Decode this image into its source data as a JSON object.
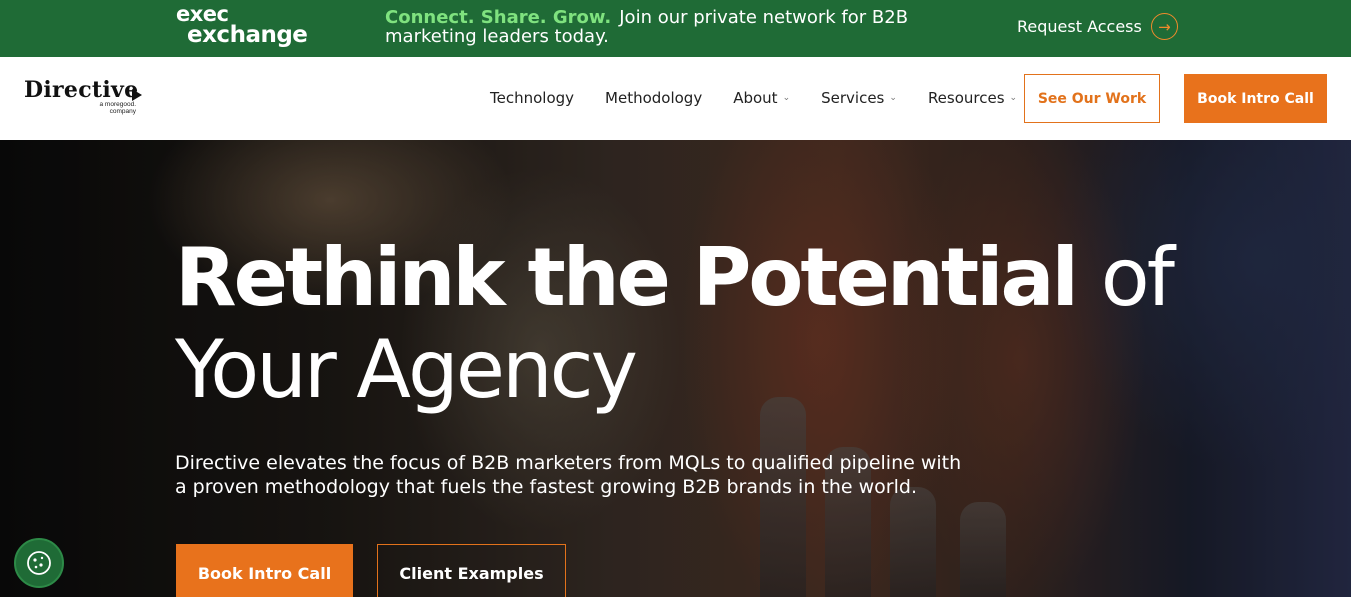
{
  "promo": {
    "logo_line1": "exec",
    "logo_line2": "exchange",
    "accent": "Connect. Share. Grow.",
    "text": "Join our private network for B2B marketing leaders today.",
    "cta": "Request Access",
    "background": "#1f6b36",
    "accent_color": "#7fe27f"
  },
  "nav": {
    "brand": "Directive",
    "brand_sub": "a moregood. company",
    "links": [
      {
        "label": "Technology",
        "dropdown": false
      },
      {
        "label": "Methodology",
        "dropdown": false
      },
      {
        "label": "About",
        "dropdown": true
      },
      {
        "label": "Services",
        "dropdown": true
      },
      {
        "label": "Resources",
        "dropdown": true
      }
    ],
    "see_work": "See Our Work",
    "book_call": "Book Intro Call",
    "accent_color": "#e8721c"
  },
  "hero": {
    "title_bold": "Rethink the Potential",
    "title_light_1": "of",
    "title_light_2": "Your Agency",
    "description": "Directive elevates the focus of B2B marketers from MQLs to qualified pipeline with a proven methodology that fuels the fastest growing B2B brands in the world.",
    "primary_button": "Book Intro Call",
    "secondary_button": "Client Examples"
  },
  "icons": {
    "promo_arrow": "arrow-right-circle-icon",
    "cookie": "cookie-icon",
    "chevron": "chevron-down-icon"
  }
}
